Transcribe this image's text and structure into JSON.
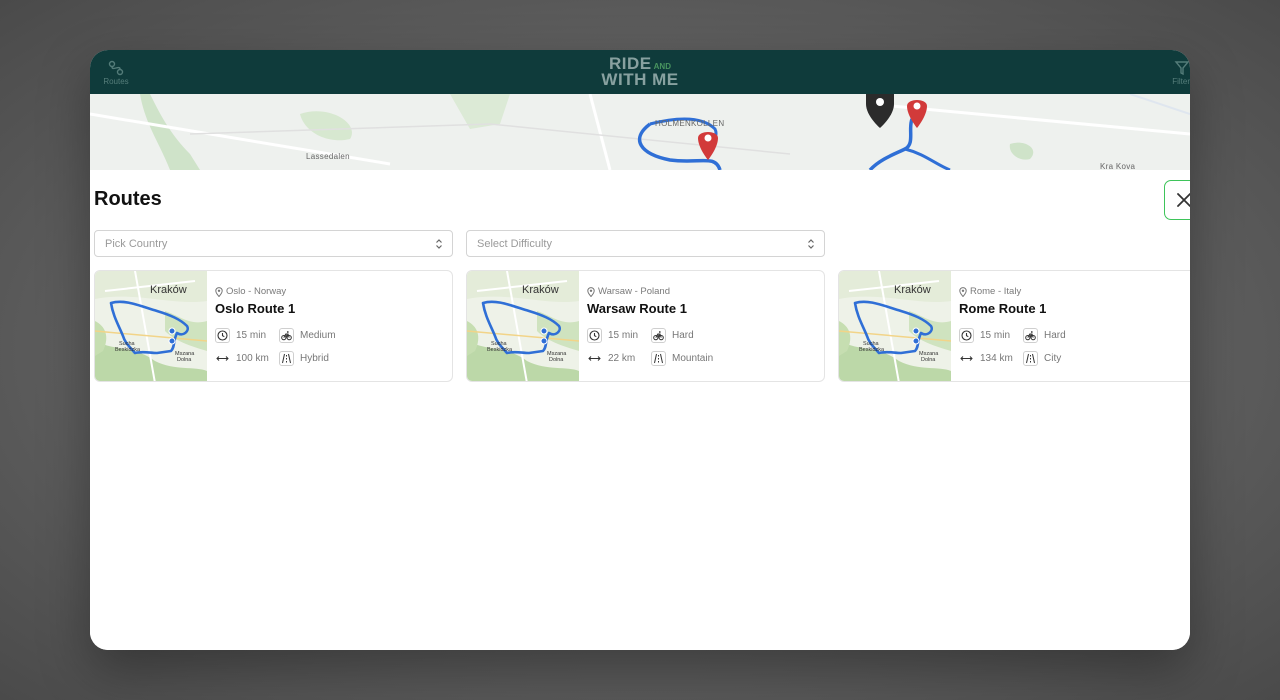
{
  "app": {
    "logo": {
      "line1": "RIDE",
      "and": "AND",
      "line2": "WITH ME"
    },
    "nav_left_label": "Routes",
    "nav_right_label": "Filter"
  },
  "map": {
    "labels": [
      "HOLMENKOLLEN",
      "Lassedalen",
      "Kra Kova"
    ]
  },
  "panel": {
    "title": "Routes",
    "filters": {
      "country_placeholder": "Pick Country",
      "difficulty_placeholder": "Select Difficulty"
    }
  },
  "thumb_labels": {
    "city": "Kraków",
    "town1": "Sucha\nBeskidzka",
    "town2": "Mszana\nDolna"
  },
  "routes": [
    {
      "location": "Oslo - Norway",
      "name": "Oslo Route 1",
      "duration": "15 min",
      "difficulty": "Medium",
      "distance": "100 km",
      "bike_type": "Hybrid"
    },
    {
      "location": "Warsaw - Poland",
      "name": "Warsaw Route 1",
      "duration": "15 min",
      "difficulty": "Hard",
      "distance": "22 km",
      "bike_type": "Mountain"
    },
    {
      "location": "Rome - Italy",
      "name": "Rome Route 1",
      "duration": "15 min",
      "difficulty": "Hard",
      "distance": "134 km",
      "bike_type": "City"
    }
  ],
  "colors": {
    "header_bg": "#0f3b3b",
    "accent_green": "#3ec45a",
    "route_blue": "#2f6fd6",
    "pin_red": "#d23a3a"
  }
}
